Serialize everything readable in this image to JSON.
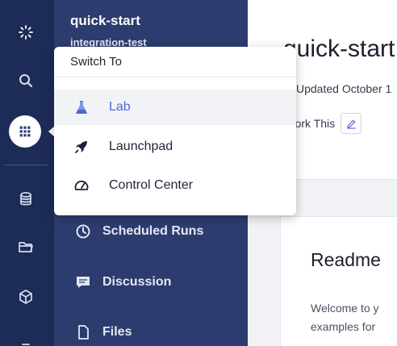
{
  "project": {
    "name": "quick-start",
    "subtitle": "integration-test"
  },
  "rail": {
    "items": [
      {
        "icon": "logo-icon"
      },
      {
        "icon": "search-icon"
      },
      {
        "icon": "apps-grid-icon",
        "active": true
      },
      {
        "icon": "database-icon"
      },
      {
        "icon": "folder-icon"
      },
      {
        "icon": "cube-icon"
      },
      {
        "icon": "more-icon"
      }
    ]
  },
  "panel": {
    "items": [
      {
        "label": "Scheduled Runs",
        "icon": "clock-icon"
      },
      {
        "label": "Discussion",
        "icon": "chat-icon"
      },
      {
        "label": "Files",
        "icon": "file-icon"
      }
    ]
  },
  "main": {
    "title": "quick-start",
    "updated": "Updated October 1",
    "action": "Fork This",
    "readme_title": "Readme",
    "readme_lines": [
      "Welcome to y",
      "examples for"
    ]
  },
  "switch_menu": {
    "header": "Switch To",
    "items": [
      {
        "label": "Lab",
        "icon": "flask-icon",
        "selected": true
      },
      {
        "label": "Launchpad",
        "icon": "rocket-icon",
        "selected": false
      },
      {
        "label": "Control Center",
        "icon": "gauge-icon",
        "selected": false
      }
    ]
  },
  "colors": {
    "rail_bg": "#1d2b57",
    "panel_bg": "#2d3c6e",
    "accent": "#4a6bd0"
  }
}
